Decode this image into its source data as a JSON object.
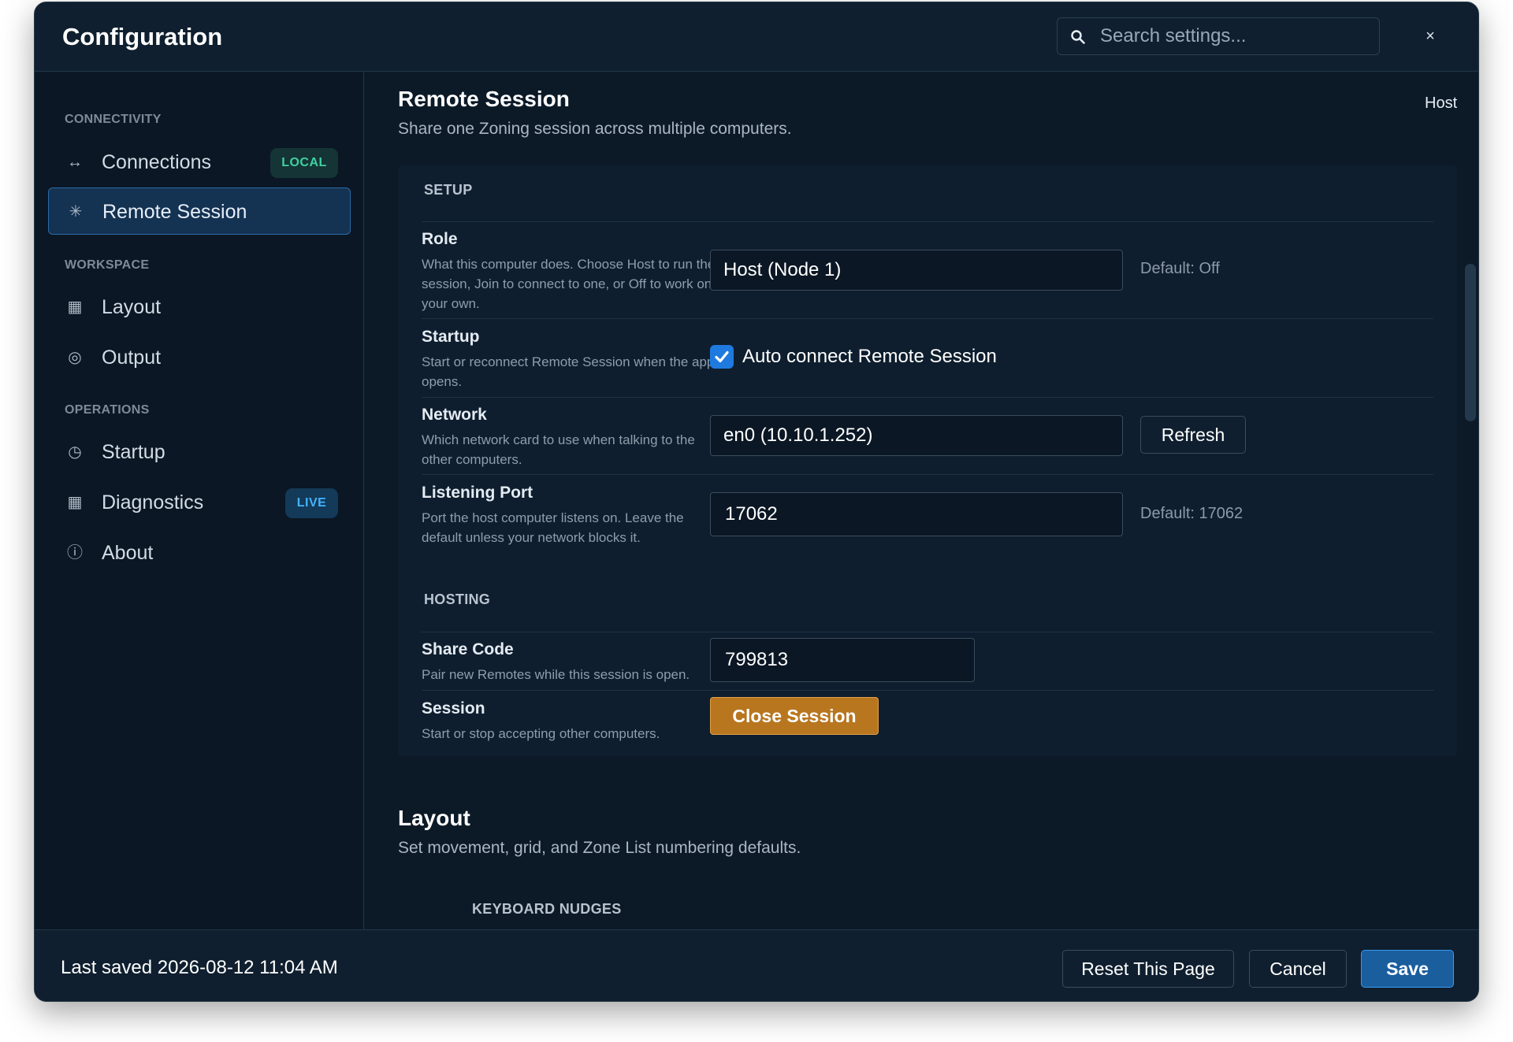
{
  "window": {
    "title": "Configuration",
    "search_placeholder": "Search settings...",
    "close_label": "×"
  },
  "sidebar": {
    "sections": [
      {
        "label": "CONNECTIVITY"
      },
      {
        "label": "WORKSPACE"
      },
      {
        "label": "OPERATIONS"
      }
    ],
    "items": [
      {
        "label": "Connections",
        "icon": "arrows-horizontal-icon",
        "glyph": "↔",
        "badge": "LOCAL"
      },
      {
        "label": "Remote Session",
        "icon": "asterisk-icon",
        "glyph": "✳",
        "active": true
      },
      {
        "label": "Layout",
        "icon": "grid-square-icon",
        "glyph": "▦"
      },
      {
        "label": "Output",
        "icon": "target-circle-icon",
        "glyph": "◎"
      },
      {
        "label": "Startup",
        "icon": "clock-icon",
        "glyph": "◷"
      },
      {
        "label": "Diagnostics",
        "icon": "grid-square-icon",
        "glyph": "▦",
        "badge": "LIVE"
      },
      {
        "label": "About",
        "icon": "info-circle-icon",
        "glyph": "ⓘ"
      }
    ]
  },
  "remote_session": {
    "title": "Remote Session",
    "description": "Share one Zoning session across multiple computers.",
    "mode": "Host",
    "setup_label": "SETUP",
    "role": {
      "title": "Role",
      "description": "What this computer does. Choose Host to run the session, Join to connect to one, or Off to work on your own.",
      "value": "Host (Node 1)",
      "hint": "Default: Off"
    },
    "startup": {
      "title": "Startup",
      "description": "Start or reconnect Remote Session when the app opens.",
      "checkbox_label": "Auto connect Remote Session",
      "checked": true
    },
    "network": {
      "title": "Network",
      "description": "Which network card to use when talking to the other computers.",
      "value": "en0 (10.10.1.252)",
      "refresh_label": "Refresh"
    },
    "port": {
      "title": "Listening Port",
      "description": "Port the host computer listens on. Leave the default unless your network blocks it.",
      "value": "17062",
      "hint": "Default: 17062"
    },
    "hosting_label": "HOSTING",
    "share_code": {
      "title": "Share Code",
      "description": "Pair new Remotes while this session is open.",
      "value": "799813"
    },
    "session": {
      "title": "Session",
      "description": "Start or stop accepting other computers.",
      "button_label": "Close Session"
    }
  },
  "layout_section": {
    "title": "Layout",
    "description": "Set movement, grid, and Zone List numbering defaults.",
    "group_label": "KEYBOARD NUDGES"
  },
  "footer": {
    "last_saved": "Last saved 2026-08-12 11:04 AM",
    "reset_label": "Reset This Page",
    "cancel_label": "Cancel",
    "save_label": "Save"
  },
  "colors": {
    "accent": "#1f7ae0",
    "warning": "#b8761f",
    "badge_local": "#3fd2a1",
    "badge_live": "#45b2ff"
  }
}
